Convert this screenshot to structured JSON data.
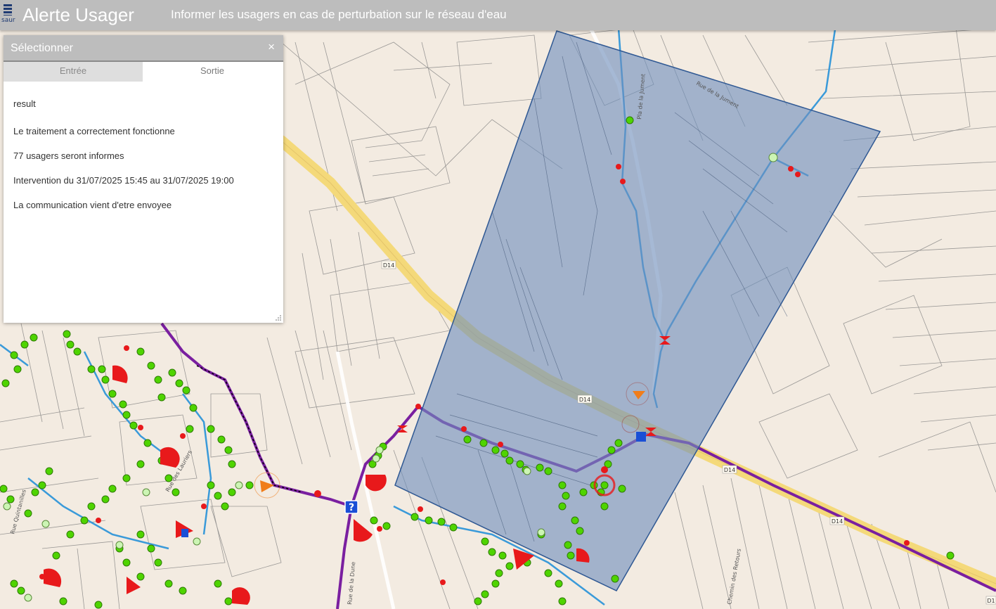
{
  "header": {
    "logo_text": "saur",
    "title": "Alerte Usager",
    "subtitle": "Informer les usagers en cas de perturbation sur le réseau d'eau"
  },
  "panel": {
    "title": "Sélectionner",
    "close_symbol": "×",
    "tabs": [
      {
        "label": "Entrée",
        "active": false
      },
      {
        "label": "Sortie",
        "active": true
      }
    ],
    "result_heading": "result",
    "messages": [
      "Le traitement a correctement fonctionne",
      "77 usagers seront informes",
      "Intervention du 31/07/2025 15:45 au 31/07/2025 19:00",
      "La communication vient d'etre envoyee"
    ]
  },
  "map": {
    "road_labels": [
      "D14",
      "D14",
      "D14",
      "D14",
      "D1"
    ],
    "street_labels": [
      "Rue des Lauriers",
      "Rue Quintanilles",
      "Chemin des Retours",
      "Rue de la Dune",
      "Rue de la Jument",
      "Pla de la Jument"
    ],
    "colors": {
      "background": "#f3ebe1",
      "road": "#f4d97a",
      "main_pipe": "#7a1fa0",
      "water_pipe": "#3a9ad9",
      "selection_fill": "#6f8fbd",
      "selection_stroke": "#2f5893",
      "customer_point": "#4fd400",
      "valve": "#e8191b"
    },
    "icons": [
      "question-marker-icon",
      "hydrant-icon"
    ]
  }
}
